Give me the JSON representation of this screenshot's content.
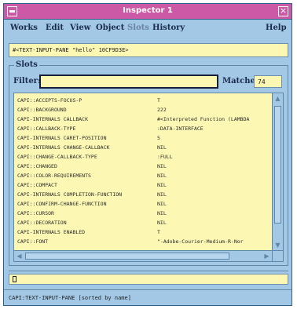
{
  "window": {
    "title": "Inspector 1"
  },
  "menubar": {
    "items": [
      "Works",
      "Edit",
      "View",
      "Object",
      "Slots",
      "History"
    ],
    "help": "Help"
  },
  "header": {
    "object": "#<TEXT-INPUT-PANE \"hello\" 10CF9D3E>"
  },
  "slots": {
    "legend": "Slots",
    "filter_label": "Filter:",
    "filter_value": "",
    "matches_label": "Matches:",
    "matches_value": "74",
    "rows": [
      {
        "key": "CAPI::ACCEPTS-FOCUS-P",
        "value": "T"
      },
      {
        "key": "CAPI::BACKGROUND",
        "value": "222"
      },
      {
        "key": "CAPI-INTERNALS CALLBACK",
        "value": "#<Interpreted Function (LAMBDA"
      },
      {
        "key": "CAPI::CALLBACK-TYPE",
        "value": ":DATA-INTERFACE"
      },
      {
        "key": "CAPI-INTERNALS CARET-POSITION",
        "value": "5"
      },
      {
        "key": "CAPI-INTERNALS CHANGE-CALLBACK",
        "value": "NIL"
      },
      {
        "key": "CAPI::CHANGE-CALLBACK-TYPE",
        "value": ":FULL"
      },
      {
        "key": "CAPI::CHANGED",
        "value": "NIL"
      },
      {
        "key": "CAPI::COLOR-REQUIREMENTS",
        "value": "NIL"
      },
      {
        "key": "CAPI::COMPACT",
        "value": "NIL"
      },
      {
        "key": "CAPI-INTERNALS COMPLETION-FUNCTION",
        "value": "NIL"
      },
      {
        "key": "CAPI::CONFIRM-CHANGE-FUNCTION",
        "value": "NIL"
      },
      {
        "key": "CAPI::CURSOR",
        "value": "NIL"
      },
      {
        "key": "CAPI::DECORATION",
        "value": "NIL"
      },
      {
        "key": "CAPI-INTERNALS ENABLED",
        "value": "T"
      },
      {
        "key": "CAPI::FONT",
        "value": "\"-Adobe-Courier-Medium-R-Nor"
      }
    ]
  },
  "command": {
    "value": ""
  },
  "status": {
    "text": "CAPI:TEXT-INPUT-PANE [sorted by name]"
  }
}
